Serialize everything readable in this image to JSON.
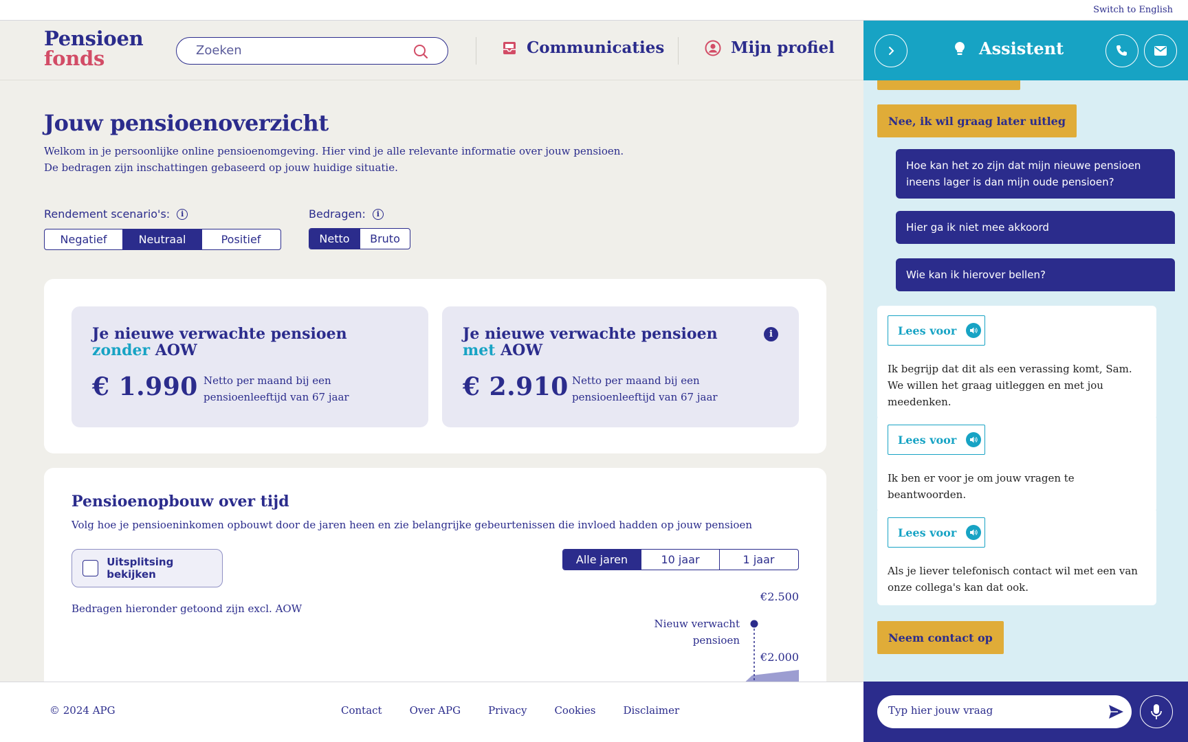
{
  "topbar": {
    "switch_language": "Switch to English"
  },
  "logo": {
    "line1": "Pensioen",
    "line2": "fonds"
  },
  "search": {
    "placeholder": "Zoeken"
  },
  "nav": {
    "communications": "Communicaties",
    "profile": "Mijn profiel"
  },
  "page": {
    "title": "Jouw pensioenoverzicht",
    "intro_line1": "Welkom in je persoonlijke online pensioenomgeving. Hier vind je alle relevante informatie over jouw pensioen.",
    "intro_line2": "De bedragen zijn inschattingen gebaseerd op jouw huidige situatie."
  },
  "scenarios": {
    "label": "Rendement scenario's:",
    "options": [
      "Negatief",
      "Neutraal",
      "Positief"
    ],
    "selected": "Neutraal"
  },
  "amounts": {
    "label": "Bedragen:",
    "options": [
      "Netto",
      "Bruto"
    ],
    "selected": "Netto"
  },
  "cards": [
    {
      "title_pre": "Je nieuwe verwachte pensioen ",
      "title_hl": "zonder",
      "title_post": " AOW",
      "amount": "€ 1.990",
      "note": "Netto per maand bij een pensioenleeftijd van 67 jaar"
    },
    {
      "title_pre": "Je nieuwe verwachte pensioen ",
      "title_hl": "met",
      "title_post": " AOW",
      "amount": "€ 2.910",
      "note": "Netto per maand bij een pensioenleeftijd van 67 jaar",
      "info": "i"
    }
  ],
  "growth": {
    "title": "Pensioenopbouw over tijd",
    "subtitle": "Volg hoe je pensioeninkomen opbouwt door de jaren heen en zie belangrijke gebeurtenissen die invloed hadden op jouw pensioen",
    "breakdown_label": "Uitsplitsing bekijken",
    "range_options": [
      "Alle jaren",
      "10 jaar",
      "1 jaar"
    ],
    "range_selected": "Alle jaren",
    "note": "Bedragen hieronder getoond zijn excl. AOW",
    "chart_data": {
      "type": "area",
      "y_ticks": [
        "€2.500",
        "€2.000"
      ],
      "marker_label_line1": "Nieuw verwacht",
      "marker_label_line2": "pensioen"
    }
  },
  "footer": {
    "copyright": "© 2024 APG",
    "links": [
      "Contact",
      "Over APG",
      "Privacy",
      "Cookies",
      "Disclaimer"
    ]
  },
  "assistant": {
    "title": "Assistent",
    "messages": {
      "chip_later": "Nee, ik wil graag later uitleg",
      "user1": "Hoe kan het zo zijn dat mijn nieuwe pensioen ineens lager is dan mijn oude pensioen?",
      "user2": "Hier ga ik niet mee akkoord",
      "user3": "Wie kan ik hierover bellen?",
      "read_aloud": "Lees voor",
      "bot1": "Ik begrijp dat dit als een verassing komt, Sam. We willen het graag uitleggen en met jou meedenken.",
      "bot2": "Ik ben er voor je om jouw vragen te beantwoorden.",
      "bot3": "Als je liever telefonisch contact wil met een van onze collega's kan dat ook.",
      "chip_contact": "Neem contact op"
    },
    "input_placeholder": "Typ hier jouw vraag"
  },
  "colors": {
    "navy": "#2b2c8c",
    "teal": "#17a3c4",
    "pink": "#d24c66",
    "gold": "#e0ac38",
    "chat_bg": "#d9eef4"
  }
}
